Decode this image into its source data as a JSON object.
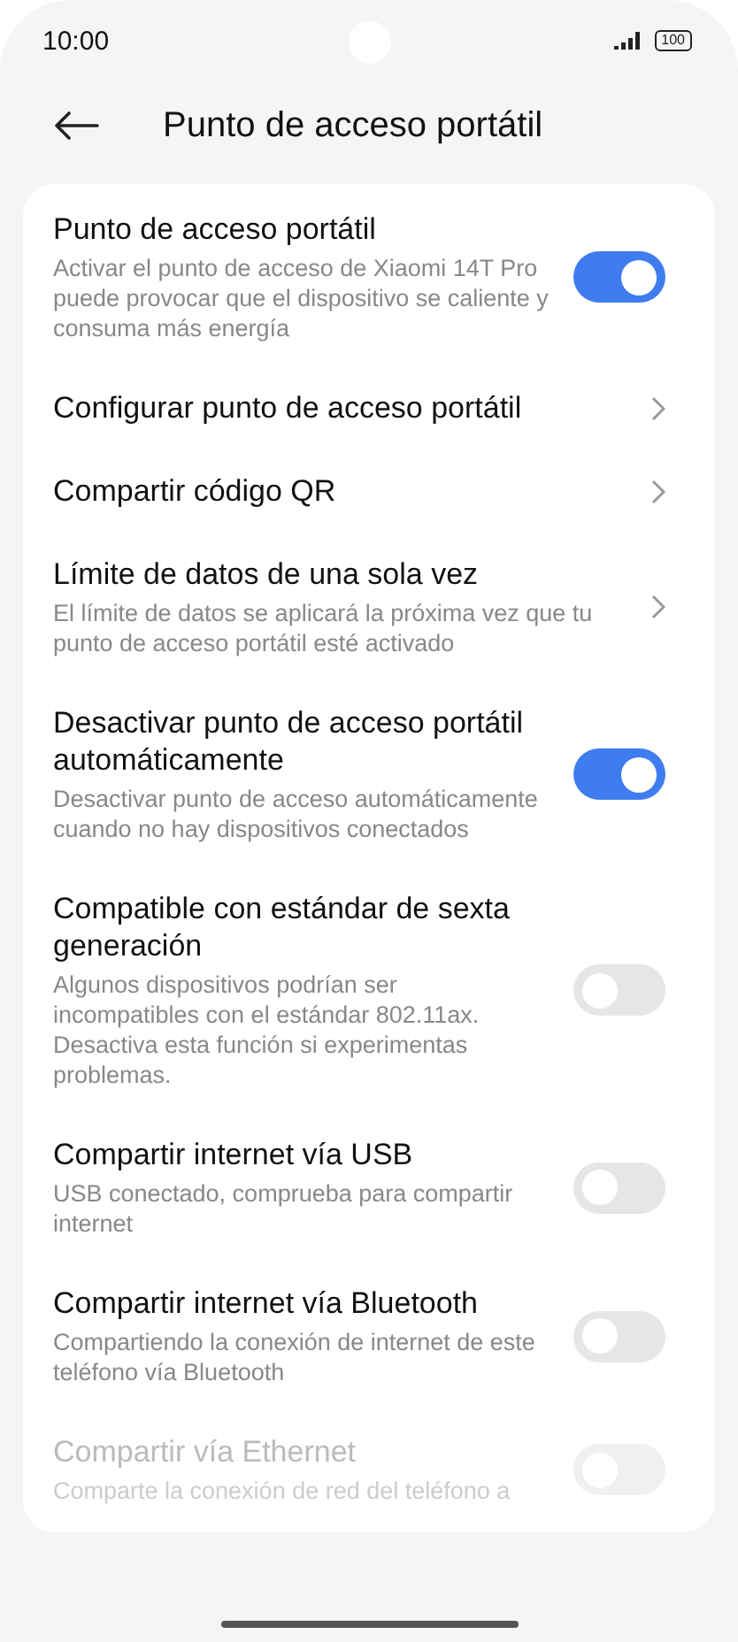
{
  "status_bar": {
    "time": "10:00",
    "battery": "100"
  },
  "header": {
    "title": "Punto de acceso portátil"
  },
  "items": [
    {
      "kind": "toggle",
      "title": "Punto de acceso portátil",
      "description": "Activar el punto de acceso de Xiaomi 14T Pro puede provocar que el dispositivo se caliente y consuma más energía",
      "on": true,
      "disabled": false
    },
    {
      "kind": "link",
      "title": "Configurar punto de acceso portátil",
      "disabled": false
    },
    {
      "kind": "link",
      "title": "Compartir código QR",
      "disabled": false
    },
    {
      "kind": "link",
      "title": "Límite de datos de una sola vez",
      "description": "El límite de datos se aplicará la próxima vez que tu punto de acceso portátil esté activado",
      "disabled": false
    },
    {
      "kind": "toggle",
      "title": "Desactivar punto de acceso portátil automáticamente",
      "description": "Desactivar punto de acceso automáticamente cuando no hay dispositivos conectados",
      "on": true,
      "disabled": false
    },
    {
      "kind": "toggle",
      "title": "Compatible con estándar de sexta generación",
      "description": "Algunos dispositivos podrían ser incompatibles con el estándar 802.11ax. Desactiva esta función si experimentas problemas.",
      "on": false,
      "disabled": false
    },
    {
      "kind": "toggle",
      "title": "Compartir internet vía USB",
      "description": "USB conectado, comprueba para compartir internet",
      "on": false,
      "disabled": false
    },
    {
      "kind": "toggle",
      "title": "Compartir internet vía Bluetooth",
      "description": "Compartiendo la conexión de internet de este teléfono vía Bluetooth",
      "on": false,
      "disabled": false
    },
    {
      "kind": "toggle",
      "title": "Compartir vía Ethernet",
      "description": "Comparte la conexión de red del teléfono a",
      "on": false,
      "disabled": true
    }
  ]
}
